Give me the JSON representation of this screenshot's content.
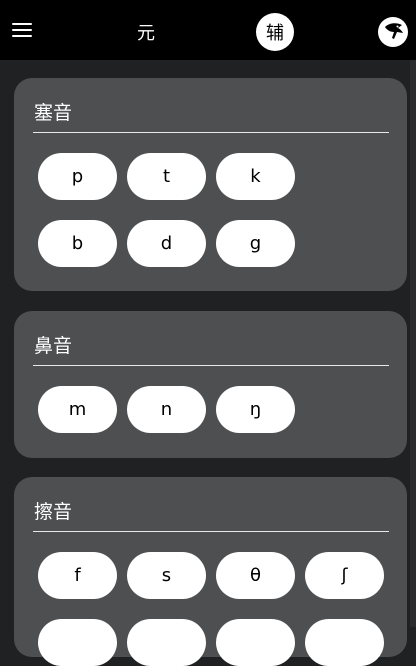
{
  "header": {
    "menu_icon": "hamburger-menu-icon",
    "tabs": [
      {
        "label": "元",
        "selected": false
      },
      {
        "label": "辅",
        "selected": true
      }
    ],
    "logo_icon": "bird-logo-icon"
  },
  "sections": [
    {
      "title": "塞音",
      "rows": [
        [
          "p",
          "t",
          "k"
        ],
        [
          "b",
          "d",
          "g"
        ]
      ]
    },
    {
      "title": "鼻音",
      "rows": [
        [
          "m",
          "n",
          "ŋ"
        ]
      ]
    },
    {
      "title": "擦音",
      "rows": [
        [
          "f",
          "s",
          "θ",
          "ʃ"
        ],
        [
          "",
          "",
          "",
          ""
        ]
      ]
    }
  ]
}
